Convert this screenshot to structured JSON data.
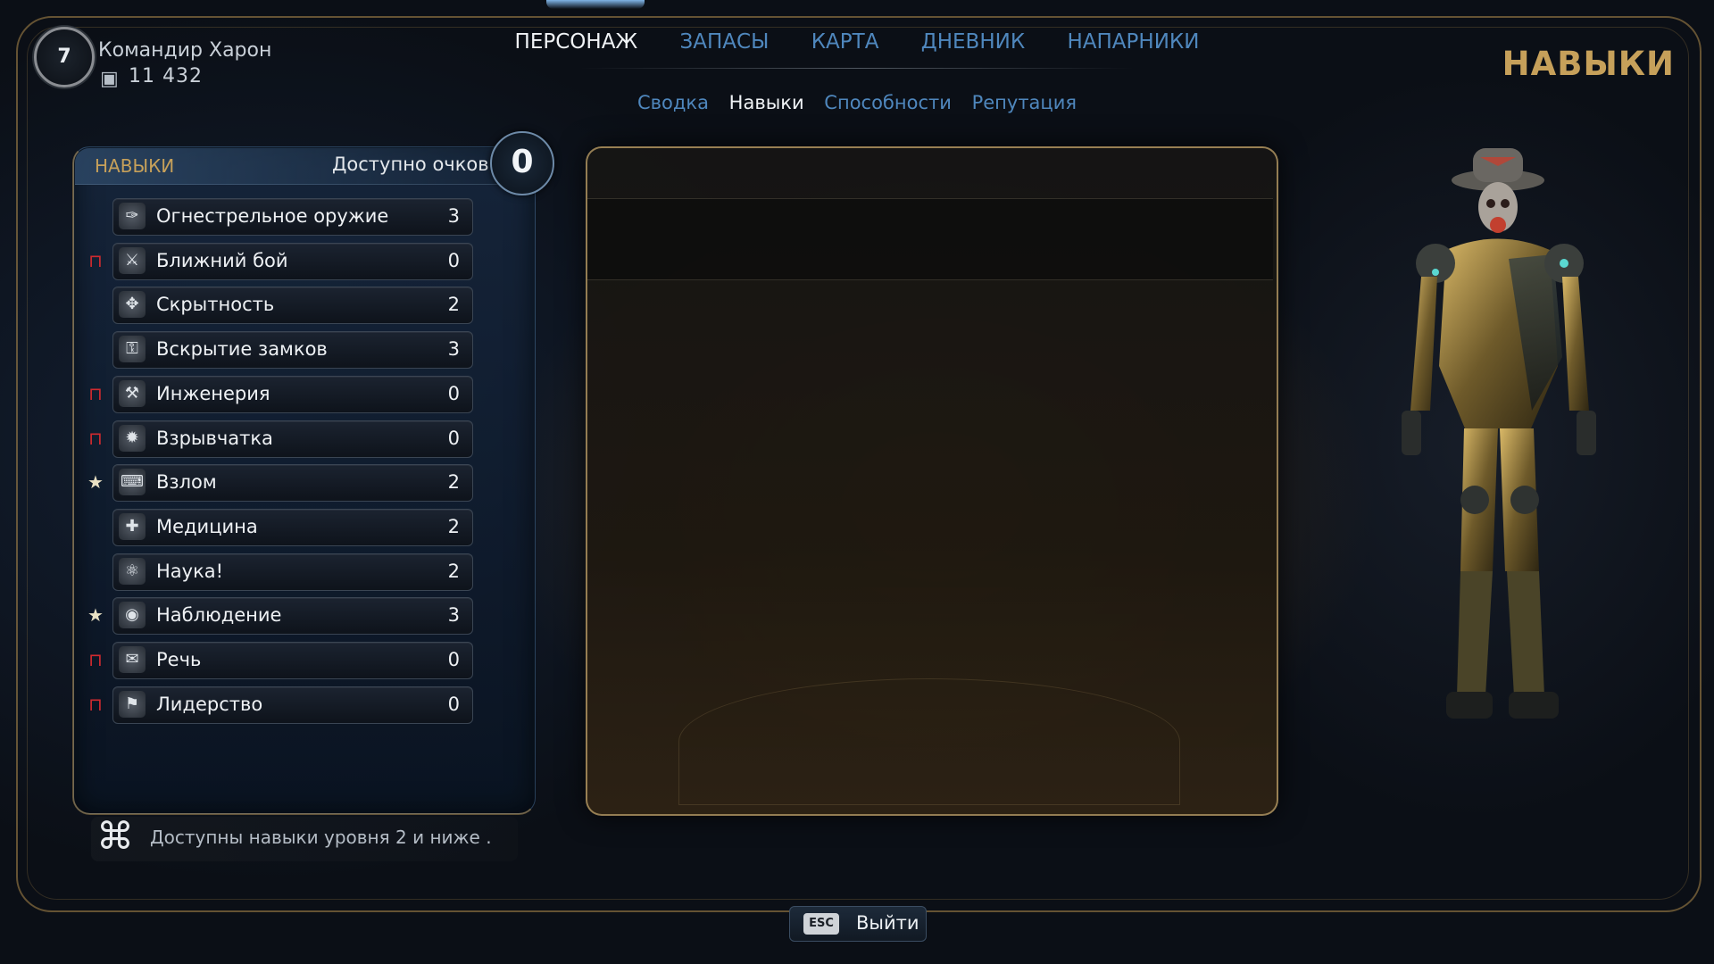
{
  "player": {
    "level": "7",
    "name": "Командир Харон",
    "money": "11 432",
    "money_icon": "bit-card-icon"
  },
  "nav": {
    "tabs": [
      "ПЕРСОНАЖ",
      "ЗАПАСЫ",
      "КАРТА",
      "ДНЕВНИК",
      "НАПАРНИКИ"
    ],
    "active_tab": 0
  },
  "subnav": {
    "tabs": [
      "Сводка",
      "Навыки",
      "Способности",
      "Репутация"
    ],
    "active_tab": 1
  },
  "page_heading": "НАВЫКИ",
  "skills_panel": {
    "title": "НАВЫКИ",
    "points_label": "Доступно очков:",
    "points_value": "0",
    "skills": [
      {
        "name": "Огнестрельное оружие",
        "value": "3",
        "icon": "✑",
        "marker": ""
      },
      {
        "name": "Ближний бой",
        "value": "0",
        "icon": "⚔",
        "marker": "lock"
      },
      {
        "name": "Скрытность",
        "value": "2",
        "icon": "✥",
        "marker": ""
      },
      {
        "name": "Вскрытие замков",
        "value": "3",
        "icon": "⚿",
        "marker": ""
      },
      {
        "name": "Инженерия",
        "value": "0",
        "icon": "⚒",
        "marker": "lock"
      },
      {
        "name": "Взрывчатка",
        "value": "0",
        "icon": "✹",
        "marker": "lock"
      },
      {
        "name": "Взлом",
        "value": "2",
        "icon": "⌨",
        "marker": "star"
      },
      {
        "name": "Медицина",
        "value": "2",
        "icon": "✚",
        "marker": ""
      },
      {
        "name": "Наука!",
        "value": "2",
        "icon": "⚛",
        "marker": ""
      },
      {
        "name": "Наблюдение",
        "value": "3",
        "icon": "◉",
        "marker": "star"
      },
      {
        "name": "Речь",
        "value": "0",
        "icon": "✉",
        "marker": "lock"
      },
      {
        "name": "Лидерство",
        "value": "0",
        "icon": "⚑",
        "marker": "lock"
      }
    ]
  },
  "hint": {
    "icon": "skill-glyph-icon",
    "text": "Доступны навыки уровня 2 и ниже ."
  },
  "exit": {
    "key": "ESC",
    "label": "Выйти"
  },
  "colors": {
    "accent_gold": "#c6a05a",
    "link_blue": "#4f87bd",
    "lock_red": "#d02a2f"
  }
}
